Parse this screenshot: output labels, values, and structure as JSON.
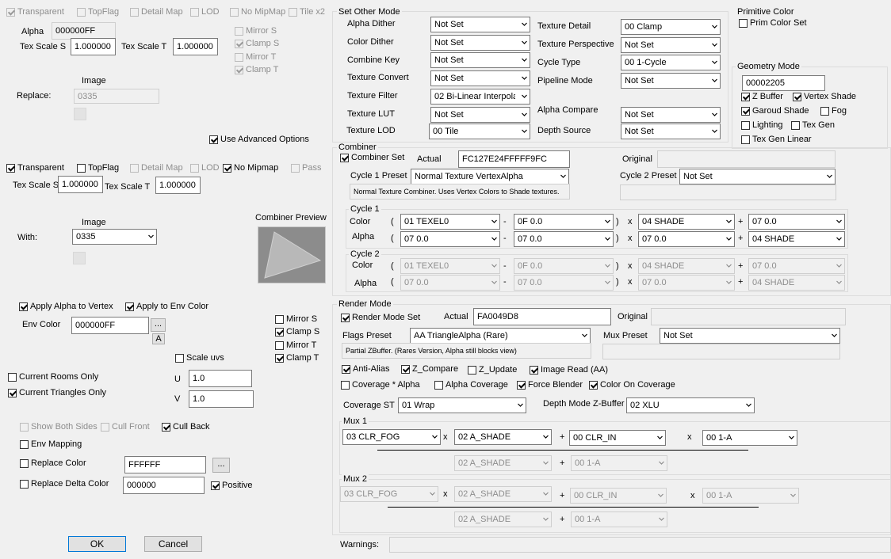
{
  "tex1": {
    "transparent": "Transparent",
    "topflag": "TopFlag",
    "detail_map": "Detail Map",
    "lod": "LOD",
    "no_mipmap": "No MipMap",
    "tile_x2": "Tile x2",
    "alpha_label": "Alpha",
    "alpha_value": "000000FF",
    "mirror_s": "Mirror S",
    "clamp_s": "Clamp S",
    "mirror_t": "Mirror T",
    "clamp_t": "Clamp T",
    "tex_scale_s_label": "Tex Scale S",
    "tex_scale_s": "1.000000",
    "tex_scale_t_label": "Tex Scale T",
    "tex_scale_t": "1.000000",
    "image_label": "Image",
    "replace_label": "Replace:",
    "replace_value": "0335",
    "use_advanced": "Use Advanced Options"
  },
  "tex2": {
    "transparent": "Transparent",
    "topflag": "TopFlag",
    "detail_map": "Detail Map",
    "lod": "LOD",
    "no_mipmap": "No Mipmap",
    "pass": "Pass",
    "tex_scale_s_label": "Tex Scale S",
    "tex_scale_s": "1.000000",
    "tex_scale_t_label": "Tex Scale T",
    "tex_scale_t": "1.000000",
    "image_label": "Image",
    "with_label": "With:",
    "with_value": "0335",
    "combiner_preview": "Combiner Preview"
  },
  "env": {
    "apply_alpha_vertex": "Apply Alpha to Vertex",
    "apply_env_color": "Apply to Env Color",
    "env_color_label": "Env Color",
    "env_color_value": "000000FF",
    "ellipsis": "...",
    "a_button": "A",
    "mirror_s": "Mirror S",
    "clamp_s": "Clamp S",
    "mirror_t": "Mirror T",
    "clamp_t": "Clamp T",
    "scale_uvs": "Scale uvs",
    "u_label": "U",
    "u_value": "1.0",
    "v_label": "V",
    "v_value": "1.0",
    "current_rooms": "Current Rooms Only",
    "current_triangles": "Current Triangles Only",
    "show_both_sides": "Show Both Sides",
    "cull_front": "Cull Front",
    "cull_back": "Cull Back",
    "env_mapping": "Env Mapping",
    "replace_color": "Replace Color",
    "replace_color_value": "FFFFFF",
    "replace_delta_color": "Replace Delta Color",
    "replace_delta_value": "000000",
    "positive": "Positive",
    "ok": "OK",
    "cancel": "Cancel"
  },
  "other_mode": {
    "title": "Set Other Mode",
    "alpha_dither": "Alpha Dither",
    "alpha_dither_value": "Not Set",
    "color_dither": "Color Dither",
    "color_dither_value": "Not Set",
    "combine_key": "Combine Key",
    "combine_key_value": "Not Set",
    "texture_convert": "Texture Convert",
    "texture_convert_value": "Not Set",
    "texture_filter": "Texture Filter",
    "texture_filter_value": "02 Bi-Linear Interpola",
    "texture_lut": "Texture LUT",
    "texture_lut_value": "Not Set",
    "texture_lod": "Texture LOD",
    "texture_lod_value": "00 Tile",
    "texture_detail": "Texture Detail",
    "texture_detail_value": "00 Clamp",
    "texture_perspective": "Texture Perspective",
    "texture_perspective_value": "Not Set",
    "cycle_type": "Cycle Type",
    "cycle_type_value": "00 1-Cycle",
    "pipeline_mode": "Pipeline Mode",
    "pipeline_mode_value": "Not Set",
    "alpha_compare": "Alpha Compare",
    "alpha_compare_value": "Not Set",
    "depth_source": "Depth Source",
    "depth_source_value": "Not Set"
  },
  "primitive": {
    "title": "Primitive Color",
    "prim_color_set": "Prim Color Set"
  },
  "geometry": {
    "title": "Geometry Mode",
    "value": "00002205",
    "z_buffer": "Z Buffer",
    "vertex_shade": "Vertex Shade",
    "garoud_shade": "Garoud Shade",
    "fog": "Fog",
    "lighting": "Lighting",
    "tex_gen": "Tex Gen",
    "tex_gen_linear": "Tex Gen Linear"
  },
  "combiner": {
    "title": "Combiner",
    "combiner_set": "Combiner Set",
    "actual_label": "Actual",
    "actual_value": "FC127E24FFFFF9FC",
    "original_label": "Original",
    "original_value": "",
    "cycle1_preset_label": "Cycle 1 Preset",
    "cycle1_preset_value": "Normal Texture VertexAlpha",
    "cycle1_desc": "Normal Texture Combiner. Uses Vertex Colors to Shade textures.",
    "cycle2_preset_label": "Cycle 2 Preset",
    "cycle2_preset_value": "Not Set",
    "cycle1_title": "Cycle 1",
    "cycle2_title": "Cycle 2",
    "color_label": "Color",
    "alpha_label": "Alpha",
    "op_open": "(",
    "op_minus": "-",
    "op_close": ")",
    "op_x": "x",
    "op_plus": "+",
    "c1_color": [
      "01 TEXEL0",
      "0F 0.0",
      "04 SHADE",
      "07 0.0"
    ],
    "c1_alpha": [
      "07 0.0",
      "07 0.0",
      "07 0.0",
      "04 SHADE"
    ],
    "c2_color": [
      "01 TEXEL0",
      "0F 0.0",
      "04 SHADE",
      "07 0.0"
    ],
    "c2_alpha": [
      "07 0.0",
      "07 0.0",
      "07 0.0",
      "04 SHADE"
    ]
  },
  "render": {
    "title": "Render Mode",
    "render_mode_set": "Render Mode Set",
    "actual_label": "Actual",
    "actual_value": "FA0049D8",
    "original_label": "Original",
    "original_value": "",
    "flags_preset_label": "Flags Preset",
    "flags_preset_value": "AA TriangleAlpha (Rare)",
    "flags_desc": "Partial ZBuffer. (Rares Version, Alpha still blocks view)",
    "mux_preset_label": "Mux Preset",
    "mux_preset_value": "Not Set",
    "anti_alias": "Anti-Alias",
    "z_compare": "Z_Compare",
    "z_update": "Z_Update",
    "image_read": "Image Read (AA)",
    "coverage_alpha": "Coverage * Alpha",
    "alpha_coverage": "Alpha Coverage",
    "force_blender": "Force Blender",
    "color_on_coverage": "Color On Coverage",
    "coverage_st_label": "Coverage ST",
    "coverage_st_value": "01 Wrap",
    "depth_mode_label": "Depth Mode Z-Buffer",
    "depth_mode_value": "02 XLU",
    "mux1_title": "Mux 1",
    "mux2_title": "Mux 2",
    "op_x": "x",
    "op_plus": "+",
    "mux1": [
      "03 CLR_FOG",
      "02 A_SHADE",
      "00 CLR_IN",
      "00 1-A",
      "02 A_SHADE",
      "00 1-A"
    ],
    "mux2": [
      "03 CLR_FOG",
      "02 A_SHADE",
      "00 CLR_IN",
      "00 1-A",
      "02 A_SHADE",
      "00 1-A"
    ]
  },
  "warnings": {
    "label": "Warnings:",
    "value": ""
  }
}
